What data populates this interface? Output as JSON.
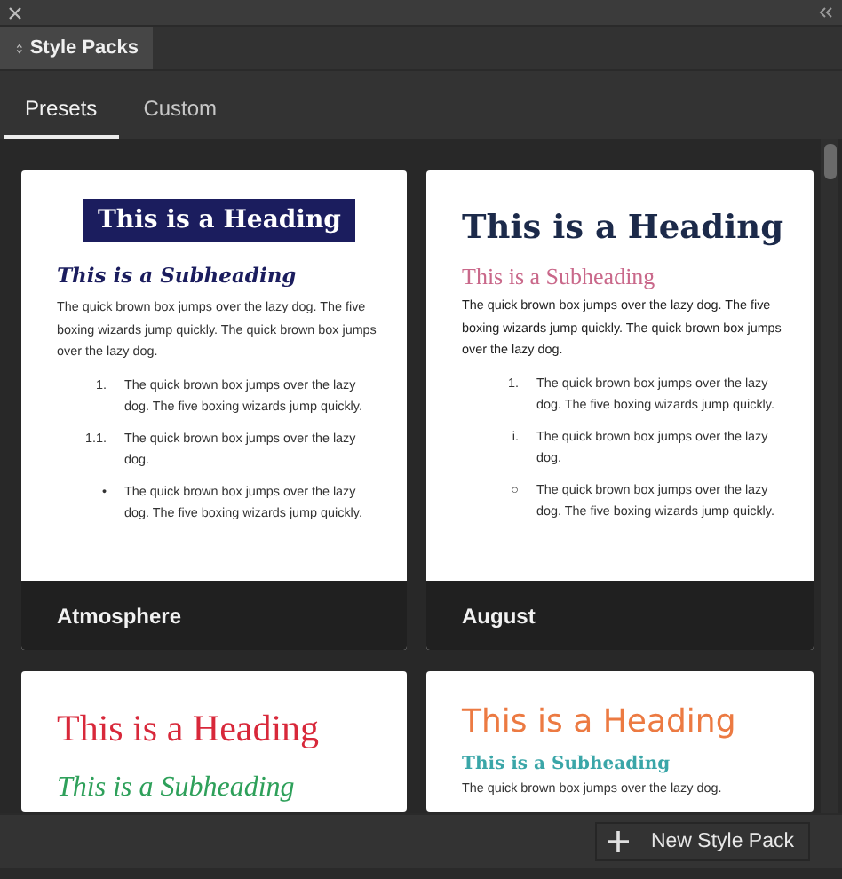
{
  "panel": {
    "title": "Style Packs"
  },
  "tabs": [
    {
      "label": "Presets",
      "selected": true
    },
    {
      "label": "Custom",
      "selected": false
    }
  ],
  "cards": [
    {
      "kind": "atmosphere",
      "heading": "This is a Heading",
      "subheading": "This is a Subheading",
      "paragraph": "The quick brown box jumps over the lazy dog. The five boxing wizards jump quickly. The quick brown box jumps over the lazy dog.",
      "list": [
        {
          "marker": "1.",
          "text": "The quick brown box jumps over the lazy dog. The five boxing wizards jump quickly."
        },
        {
          "marker": "1.1.",
          "text": "The quick brown box jumps over the lazy dog."
        },
        {
          "marker": "•",
          "text": "The quick brown box jumps over the lazy dog. The five boxing wizards jump quickly."
        }
      ],
      "name": "Atmosphere"
    },
    {
      "kind": "august",
      "heading": "This is a Heading",
      "subheading": "This is a Subheading",
      "paragraph": "The quick brown box jumps over the lazy dog. The five boxing wizards jump quickly. The quick brown box jumps over the lazy dog.",
      "list": [
        {
          "marker": "1.",
          "text": "The quick brown box jumps over the lazy dog. The five boxing wizards jump quickly."
        },
        {
          "marker": "i.",
          "text": "The quick brown box jumps over the lazy dog."
        },
        {
          "marker": "○",
          "text": "The quick brown box jumps over the lazy dog. The five boxing wizards jump quickly."
        }
      ],
      "name": "August"
    },
    {
      "kind": "crimson",
      "heading": "This is a Heading",
      "subheading": "This is a Subheading"
    },
    {
      "kind": "coral",
      "heading": "This is a Heading",
      "subheading": "This is a Subheading",
      "paragraph": "The quick brown box jumps over the lazy dog."
    }
  ],
  "new_button": {
    "label": "New Style Pack"
  }
}
